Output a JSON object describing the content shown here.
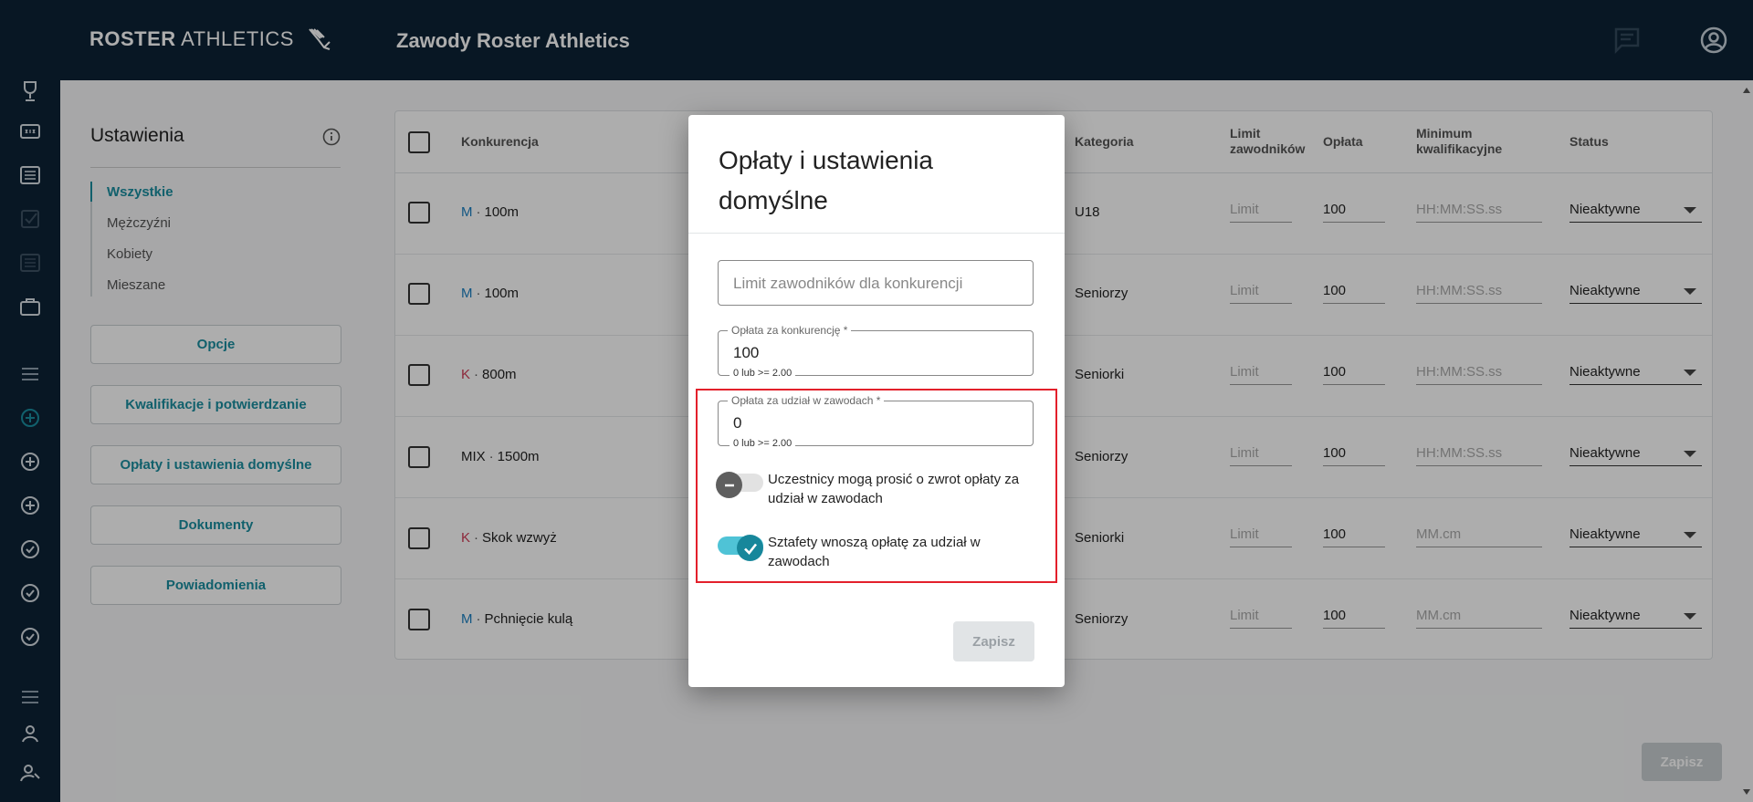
{
  "header": {
    "logo_bold": "ROSTER",
    "logo_light": "ATHLETICS",
    "app_title": "Zawody Roster Athletics"
  },
  "settings": {
    "title": "Ustawienia",
    "filters": [
      "Wszystkie",
      "Mężczyźni",
      "Kobiety",
      "Mieszane"
    ],
    "buttons": [
      "Opcje",
      "Kwalifikacje i potwierdzanie",
      "Opłaty i ustawienia domyślne",
      "Dokumenty",
      "Powiadomienia"
    ]
  },
  "table": {
    "headers": {
      "event": "Konkurencja",
      "category": "Kategoria",
      "limit": "Limit zawodników",
      "fee": "Opłata",
      "minimum": "Minimum kwalifikacyjne",
      "status": "Status"
    },
    "rows": [
      {
        "gender": "M",
        "event": "100m",
        "category": "U18",
        "limit": "Limit",
        "fee": "100",
        "minimum": "HH:MM:SS.ss",
        "status": "Nieaktywne"
      },
      {
        "gender": "M",
        "event": "100m",
        "category": "Seniorzy",
        "limit": "Limit",
        "fee": "100",
        "minimum": "HH:MM:SS.ss",
        "status": "Nieaktywne"
      },
      {
        "gender": "K",
        "event": "800m",
        "category": "Seniorki",
        "limit": "Limit",
        "fee": "100",
        "minimum": "HH:MM:SS.ss",
        "status": "Nieaktywne"
      },
      {
        "gender": "MIX",
        "event": "1500m",
        "category": "Seniorzy",
        "limit": "Limit",
        "fee": "100",
        "minimum": "HH:MM:SS.ss",
        "status": "Nieaktywne"
      },
      {
        "gender": "K",
        "event": "Skok wzwyż",
        "category": "Seniorki",
        "limit": "Limit",
        "fee": "100",
        "minimum": "MM.cm",
        "status": "Nieaktywne"
      },
      {
        "gender": "M",
        "event": "Pchnięcie kulą",
        "category": "Seniorzy",
        "limit": "Limit",
        "fee": "100",
        "minimum": "MM.cm",
        "status": "Nieaktywne"
      }
    ],
    "save_label": "Zapisz"
  },
  "modal": {
    "title": "Opłaty i ustawienia domyślne",
    "limit_placeholder": "Limit zawodników dla konkurencji",
    "event_fee": {
      "label": "Opłata za konkurencję *",
      "value": "100",
      "hint": "0 lub >= 2.00"
    },
    "participation_fee": {
      "label": "Opłata za udział w zawodach *",
      "value": "0",
      "hint": "0 lub >= 2.00"
    },
    "toggle_refund": {
      "label": "Uczestnicy mogą prosić o zwrot opłaty za udział w zawodach",
      "on": false
    },
    "toggle_relays": {
      "label": "Sztafety wnoszą opłatę za udział w zawodach",
      "on": true
    },
    "save_label": "Zapisz"
  },
  "colors": {
    "accent": "#1a8ea0",
    "nav_bg": "#0d2236",
    "toggle_on": "#4fc3d6",
    "highlight": "#e3202b"
  }
}
